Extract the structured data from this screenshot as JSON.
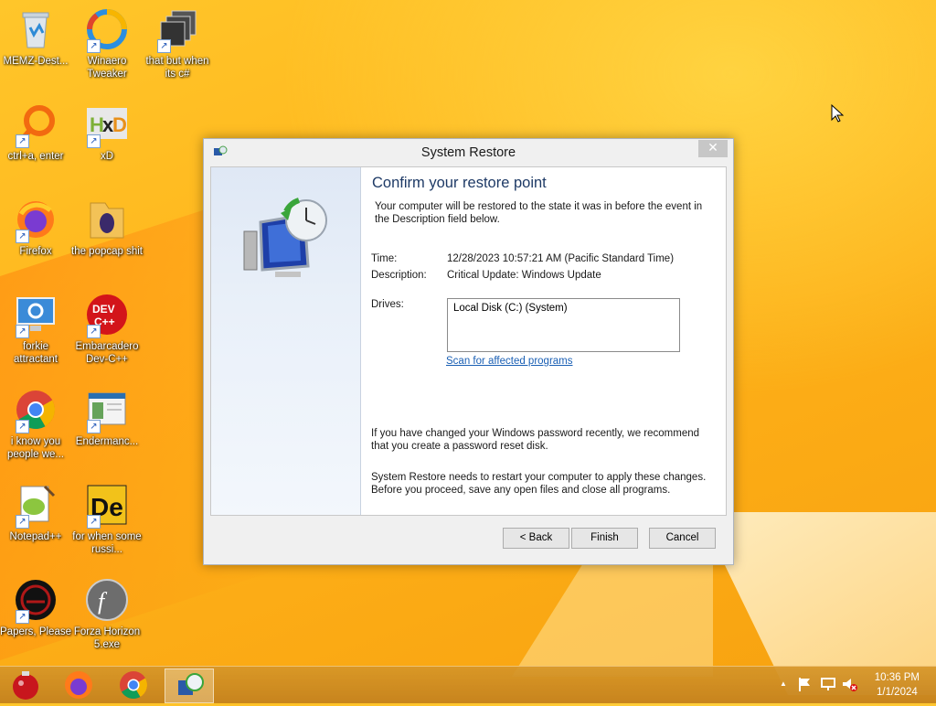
{
  "desktop": {
    "icons": [
      {
        "label": "MEMZ-Dest...",
        "icon": "recycle-bin-icon"
      },
      {
        "label": "Winaero Tweaker",
        "icon": "winaero-icon"
      },
      {
        "label": "that but when its c#",
        "icon": "stacked-windows-icon"
      },
      {
        "label": "ctrl+a, enter",
        "icon": "orange-magnifier-icon"
      },
      {
        "label": "xD",
        "icon": "hxd-icon"
      },
      {
        "label": "Firefox",
        "icon": "firefox-icon"
      },
      {
        "label": "the popcap shit",
        "icon": "folder-icon"
      },
      {
        "label": "forkie attractant",
        "icon": "monitor-gear-icon"
      },
      {
        "label": "Embarcadero Dev-C++",
        "icon": "devcpp-icon"
      },
      {
        "label": "i know you people we...",
        "icon": "chrome-icon"
      },
      {
        "label": "Endermanc...",
        "icon": "window-app-icon"
      },
      {
        "label": "Notepad++",
        "icon": "notepadpp-icon"
      },
      {
        "label": "for when some russi...",
        "icon": "de-icon"
      },
      {
        "label": "Papers, Please",
        "icon": "papers-please-icon"
      },
      {
        "label": "Forza Horizon 5.exe",
        "icon": "flash-icon"
      }
    ]
  },
  "dialog": {
    "title": "System Restore",
    "close_glyph": "✕",
    "heading": "Confirm your restore point",
    "intro": "Your computer will be restored to the state it was in before the event in the Description field below.",
    "time_label": "Time:",
    "time_value": "12/28/2023 10:57:21 AM (Pacific Standard Time)",
    "description_label": "Description:",
    "description_value": "Critical Update: Windows Update",
    "drives_label": "Drives:",
    "drives_value": "Local Disk (C:) (System)",
    "scan_link": "Scan for affected programs",
    "password_note": "If you have changed your Windows password recently, we recommend that you create a password reset disk.",
    "restart_note": "System Restore needs to restart your computer to apply these changes. Before you proceed, save any open files and close all programs.",
    "back_label": "< Back",
    "finish_label": "Finish",
    "cancel_label": "Cancel"
  },
  "taskbar": {
    "apps": [
      {
        "name": "ornament-app-icon"
      },
      {
        "name": "firefox-taskbar-icon"
      },
      {
        "name": "chrome-taskbar-icon"
      },
      {
        "name": "system-restore-taskbar-icon"
      }
    ],
    "tray_chevron": "▲",
    "time": "10:36 PM",
    "date": "1/1/2024"
  },
  "colors": {
    "accent": "#1e3a66",
    "link": "#1a5fb4",
    "wallpaper": "#ffb31a"
  }
}
